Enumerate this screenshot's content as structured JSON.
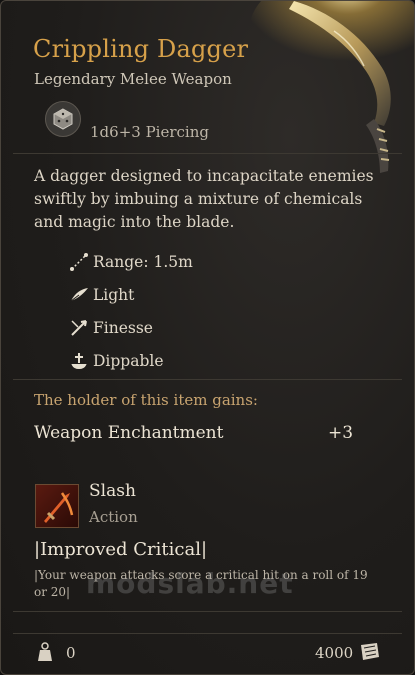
{
  "item": {
    "name": "Crippling Dagger",
    "rarity_type": "Legendary Melee Weapon",
    "damage": "1d6+3 Piercing",
    "description": "A dagger designed to incapacitate enemies swiftly by imbuing a mixture of chemicals and magic into the blade.",
    "properties": [
      {
        "icon": "range-icon",
        "label": "Range: 1.5m"
      },
      {
        "icon": "feather-icon",
        "label": "Light"
      },
      {
        "icon": "finesse-icon",
        "label": "Finesse"
      },
      {
        "icon": "flask-icon",
        "label": "Dippable"
      }
    ],
    "holder_gains_label": "The holder of this item gains:",
    "enchantment": {
      "name": "Weapon Enchantment",
      "value": "+3"
    },
    "action": {
      "name": "Slash",
      "type": "Action"
    },
    "passive": {
      "title": "|Improved Critical|",
      "description": "|Your weapon attacks score a critical hit on a roll of 19 or 20|"
    },
    "weight": "0",
    "price": "4000"
  },
  "watermark": "modslab.net",
  "colors": {
    "title": "#d7a14a",
    "holder_text": "#c8a470",
    "background": "#1f1d1b"
  }
}
